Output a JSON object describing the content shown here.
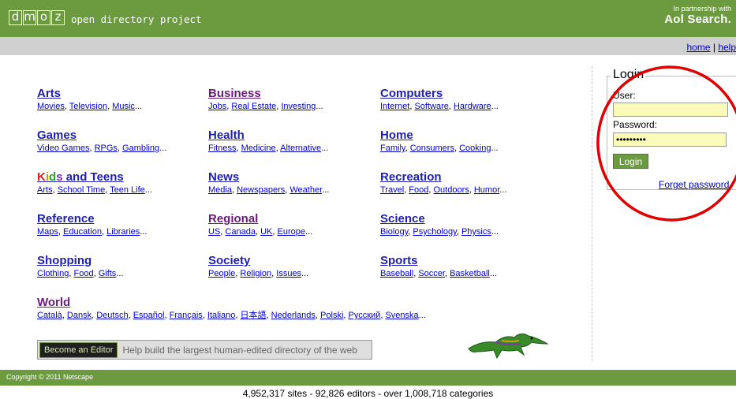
{
  "header": {
    "logo_letters": [
      "d",
      "m",
      "o",
      "z"
    ],
    "tagline": "open directory project",
    "partner_small": "In partnership with",
    "partner_brand": "Aol Search."
  },
  "nav": {
    "home": "home",
    "sep": "|",
    "help": "help"
  },
  "categories": [
    {
      "title": "Arts",
      "subs": [
        "Movies",
        "Television",
        "Music"
      ]
    },
    {
      "title": "Business",
      "subs": [
        "Jobs",
        "Real Estate",
        "Investing"
      ]
    },
    {
      "title": "Computers",
      "subs": [
        "Internet",
        "Software",
        "Hardware"
      ]
    },
    {
      "title": "Games",
      "subs": [
        "Video Games",
        "RPGs",
        "Gambling"
      ]
    },
    {
      "title": "Health",
      "subs": [
        "Fitness",
        "Medicine",
        "Alternative"
      ]
    },
    {
      "title": "Home",
      "subs": [
        "Family",
        "Consumers",
        "Cooking"
      ]
    },
    {
      "title": "Kids and Teens",
      "subs": [
        "Arts",
        "School Time",
        "Teen Life"
      ]
    },
    {
      "title": "News",
      "subs": [
        "Media",
        "Newspapers",
        "Weather"
      ]
    },
    {
      "title": "Recreation",
      "subs": [
        "Travel",
        "Food",
        "Outdoors",
        "Humor"
      ]
    },
    {
      "title": "Reference",
      "subs": [
        "Maps",
        "Education",
        "Libraries"
      ]
    },
    {
      "title": "Regional",
      "subs": [
        "US",
        "Canada",
        "UK",
        "Europe"
      ]
    },
    {
      "title": "Science",
      "subs": [
        "Biology",
        "Psychology",
        "Physics"
      ]
    },
    {
      "title": "Shopping",
      "subs": [
        "Clothing",
        "Food",
        "Gifts"
      ]
    },
    {
      "title": "Society",
      "subs": [
        "People",
        "Religion",
        "Issues"
      ]
    },
    {
      "title": "Sports",
      "subs": [
        "Baseball",
        "Soccer",
        "Basketball"
      ]
    },
    {
      "title": "World",
      "subs": [
        "Català",
        "Dansk",
        "Deutsch",
        "Español",
        "Français",
        "Italiano",
        "日本語",
        "Nederlands",
        "Polski",
        "Русский",
        "Svenska"
      ]
    }
  ],
  "kids_title_parts": [
    "K",
    "i",
    "d",
    "s",
    " and Teens"
  ],
  "editor": {
    "button": "Become an Editor",
    "help": "Help build the largest human-edited directory of the web"
  },
  "login": {
    "legend": "Login",
    "user_label": "User:",
    "user_value": "",
    "password_label": "Password:",
    "password_value": "•••••••••",
    "button": "Login",
    "forgot": "Forget password"
  },
  "footer": {
    "copyright": "Copyright © 2011 Netscape",
    "stats": "4,952,317 sites - 92,826 editors - over 1,008,718 categories"
  },
  "colors": {
    "brand_green": "#6b9a3f",
    "link": "#0000cc",
    "title_link": "#2020b0",
    "visited": "#6a1b7a",
    "annotation_red": "#e00000",
    "input_bg": "#fbfbb8"
  },
  "ellipsis": "..."
}
